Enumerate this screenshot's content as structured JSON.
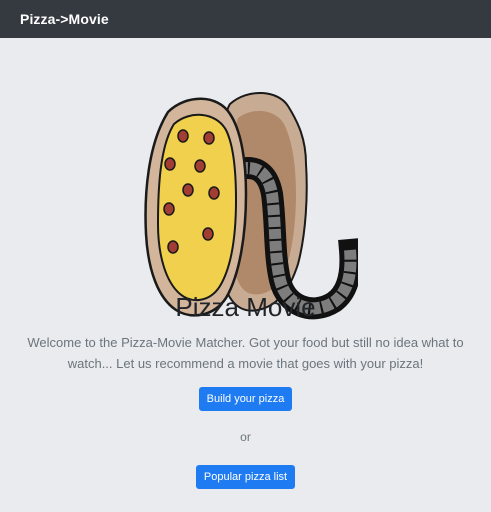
{
  "navbar": {
    "brand": "Pizza->Movie"
  },
  "hero": {
    "logo_icon": "pizza-film-reel-icon",
    "title": "Pizza Movie",
    "lead": "Welcome to the Pizza-Movie Matcher. Got your food but still no idea what to watch... Let us recommend a movie that goes with your pizza!"
  },
  "actions": {
    "build_label": "Build your pizza",
    "or_text": "or",
    "popular_label": "Popular pizza list"
  },
  "colors": {
    "navbar_bg": "#343a40",
    "page_bg": "#e9ebee",
    "primary": "#1f7bf2",
    "muted_text": "#6c757d",
    "cheese": "#f0d04c",
    "pepperoni": "#a23d33",
    "crust": "#d2b59a"
  }
}
